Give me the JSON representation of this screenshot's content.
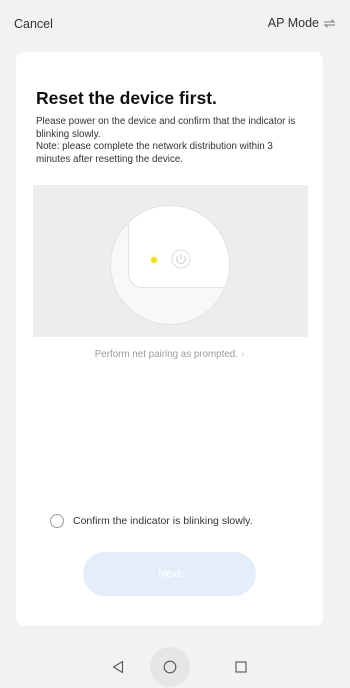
{
  "header": {
    "cancel_label": "Cancel",
    "mode_label": "AP Mode"
  },
  "card": {
    "title": "Reset the device first.",
    "instruction": "Please power on the device and confirm that the indicator is blinking slowly.",
    "note": "Note: please complete the network distribution within 3 minutes after resetting the device.",
    "pairing_link": "Perform net pairing as prompted.",
    "confirm_label": "Confirm the indicator is blinking slowly.",
    "confirm_checked": false,
    "next_label": "Next"
  },
  "colors": {
    "accent_disabled": "#e4eefb",
    "indicator_led": "#f0e020"
  },
  "icons": {
    "mode_switch": "swap-arrows-icon",
    "power": "power-icon",
    "chevron": "chevron-right-icon",
    "nav_back": "triangle-back-icon",
    "nav_home": "circle-home-icon",
    "nav_recents": "square-recents-icon"
  }
}
